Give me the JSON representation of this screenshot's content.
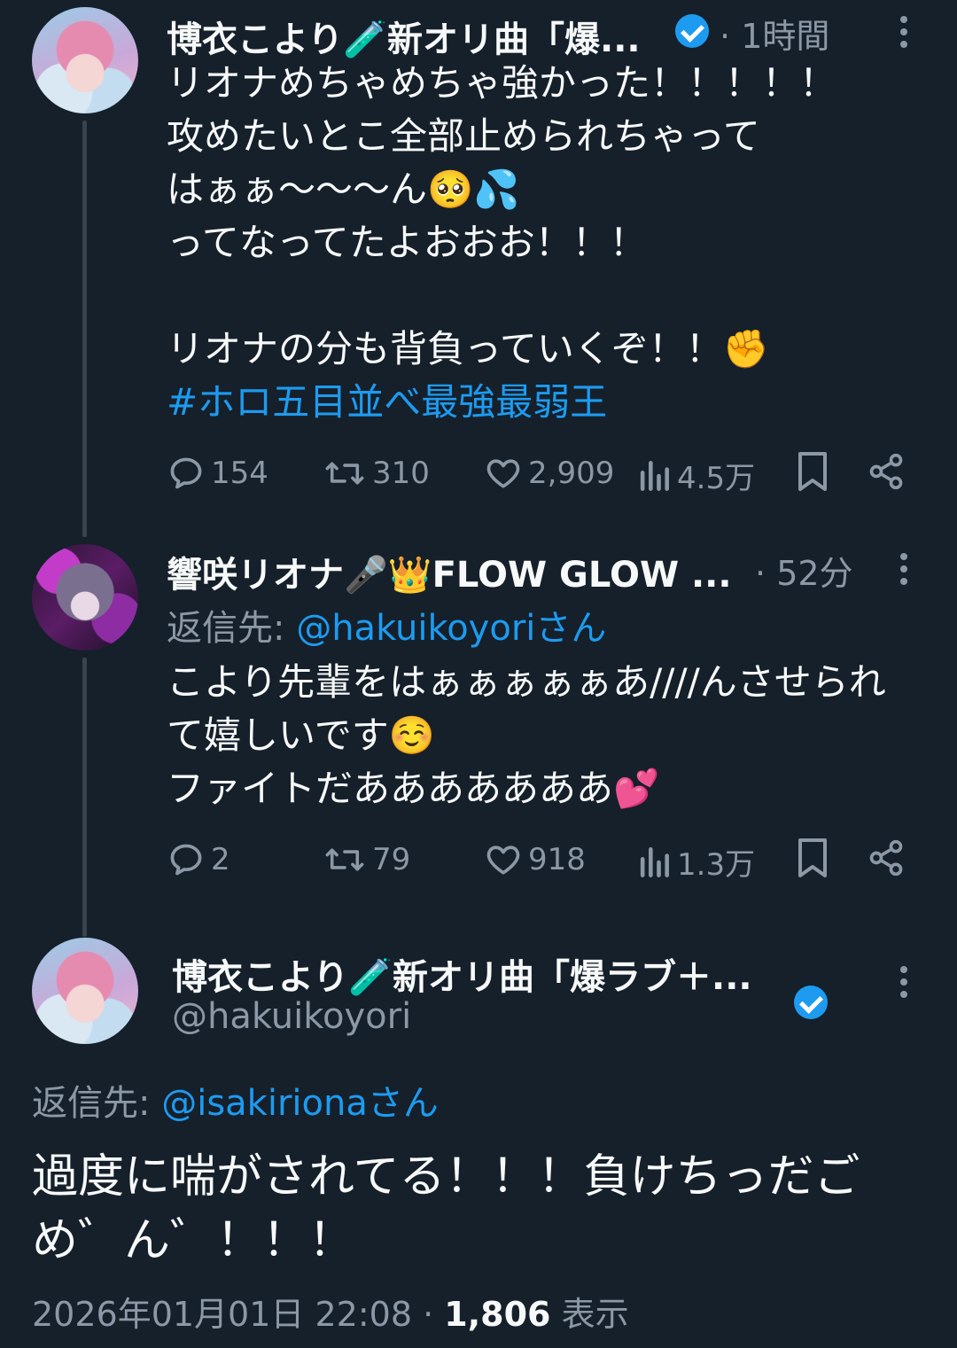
{
  "tweet1": {
    "display_name": "博衣こより🧪新オリ曲「爆...",
    "separator": "·",
    "time": "1時間",
    "body": "リオナめちゃめちゃ強かった！！！！！\n攻めたいとこ全部止められちゃって\nはぁぁ〜〜〜ん🥺💦\nってなってたよおおお！！！\n\nリオナの分も背負っていくぞ！！✊",
    "hashtag": "#ホロ五目並べ最強最弱王",
    "replies": "154",
    "retweets": "310",
    "likes": "2,909",
    "views": "4.5万"
  },
  "tweet2": {
    "display_name": "響咲リオナ🎤👑FLOW GLOW ...",
    "separator": "·",
    "time": "52分",
    "reply_to_label": "返信先: ",
    "reply_to_handle": "@hakuikoyoriさん",
    "body": "こより先輩をはぁぁぁぁぁあ////んさせられ\nて嬉しいです☺️\nファイトだあああああああ💕",
    "replies": "2",
    "retweets": "79",
    "likes": "918",
    "views": "1.3万"
  },
  "tweet3": {
    "display_name": "博衣こより🧪新オリ曲「爆ラブ＋...",
    "handle": "@hakuikoyori",
    "reply_to_label": "返信先: ",
    "reply_to_handle": "@isakirionaさん",
    "body": "過度に喘がされてる！！！負けちっだご\nめ゛ん゛！！！",
    "timestamp": "2026年01月01日 22:08",
    "separator": "·",
    "views_count": "1,806",
    "views_label": "表示"
  },
  "colors": {
    "background": "#15202b",
    "accent": "#1d9bf0",
    "muted": "#8b98a5"
  }
}
